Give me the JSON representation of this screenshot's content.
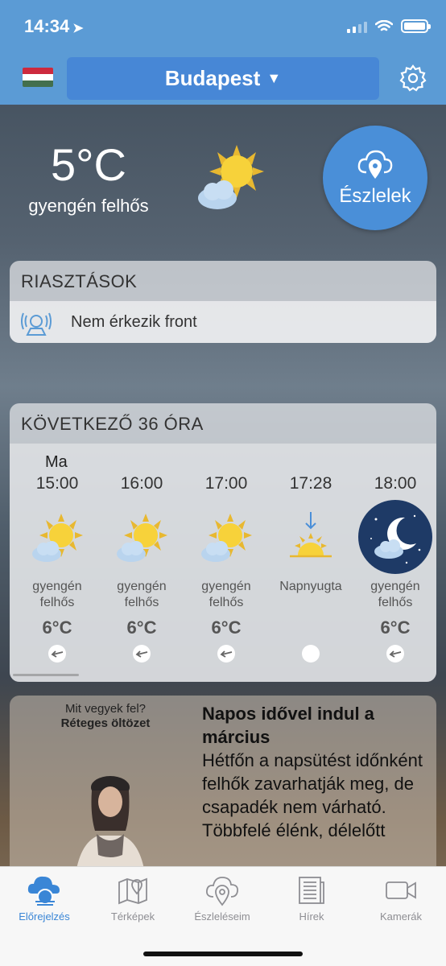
{
  "status": {
    "time": "14:34"
  },
  "header": {
    "city": "Budapest"
  },
  "current": {
    "temp": "5°C",
    "desc": "gyengén felhős",
    "observe_label": "Észlelek"
  },
  "alerts": {
    "title": "RIASZTÁSOK",
    "message": "Nem érkezik front"
  },
  "forecast": {
    "title": "KÖVETKEZŐ 36 ÓRA",
    "day_label": "Ma",
    "hours": [
      {
        "time": "15:00",
        "desc1": "gyengén",
        "desc2": "felhős",
        "temp": "6°C",
        "icon": "partly-cloudy-day"
      },
      {
        "time": "16:00",
        "desc1": "gyengén",
        "desc2": "felhős",
        "temp": "6°C",
        "icon": "partly-cloudy-day"
      },
      {
        "time": "17:00",
        "desc1": "gyengén",
        "desc2": "felhős",
        "temp": "6°C",
        "icon": "partly-cloudy-day"
      },
      {
        "time": "17:28",
        "desc1": "Napnyugta",
        "desc2": "",
        "temp": "",
        "icon": "sunset"
      },
      {
        "time": "18:00",
        "desc1": "gyengén",
        "desc2": "felhős",
        "temp": "6°C",
        "icon": "partly-cloudy-night"
      }
    ]
  },
  "news": {
    "question": "Mit vegyek fel?",
    "answer": "Réteges öltözet",
    "title": "Napos idővel indul a március",
    "text": "Hétfőn a napsütést időnként felhők zavarhatják meg, de csapadék nem várható. Többfelé élénk, délelőtt"
  },
  "tabs": {
    "forecast": "Előrejelzés",
    "maps": "Térképek",
    "observations": "Észleléseim",
    "news": "Hírek",
    "cameras": "Kamerák"
  },
  "colors": {
    "accent": "#3a86d6",
    "header": "#5b9bd5"
  }
}
